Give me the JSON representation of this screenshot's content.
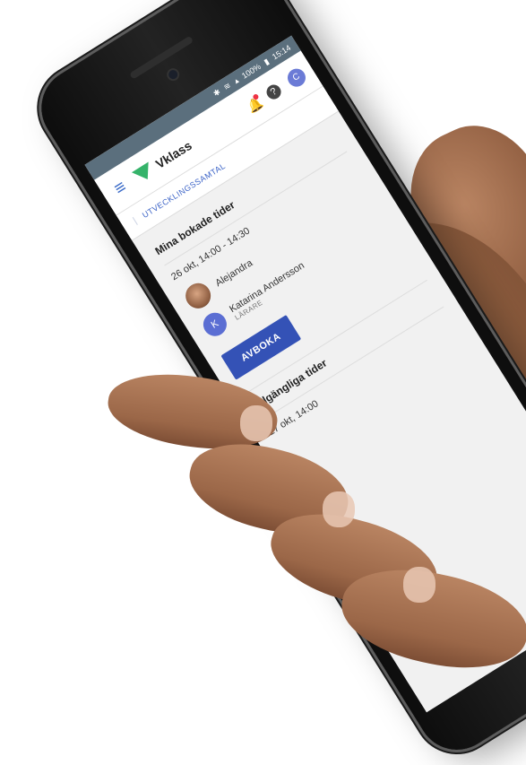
{
  "status": {
    "battery": "100%",
    "time": "15:14"
  },
  "app": {
    "brand": "Vklass",
    "user_initial": "C",
    "help_symbol": "?"
  },
  "nav": {
    "tab": "UTVECKLINGSSAMTAL"
  },
  "booked": {
    "title": "Mina bokade tider",
    "slot_time": "26 okt, 14:00 - 14:30",
    "student_name": "Alejandra",
    "teacher_initial": "K",
    "teacher_name": "Katarina Andersson",
    "teacher_role": "LÄRARE",
    "cancel_label": "AVBOKA"
  },
  "available": {
    "title": "Tillgängliga tider",
    "slot_time": "27 okt, 14:00"
  },
  "colors": {
    "accent": "#3452b6",
    "brand_green": "#35b36a",
    "statusbar": "#5b6f7d"
  }
}
